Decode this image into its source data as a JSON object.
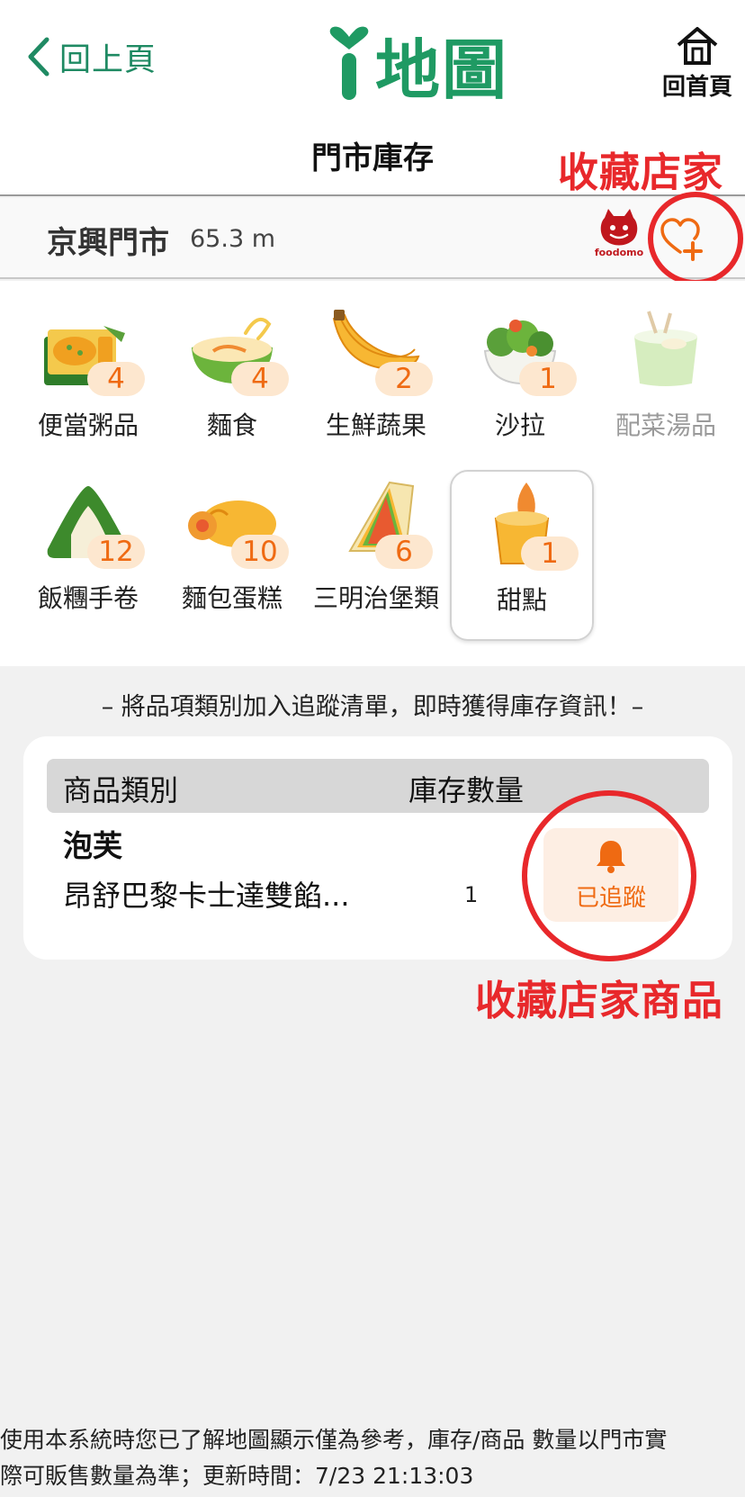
{
  "header": {
    "back_label": "回上頁",
    "logo_text": "地圖",
    "home_label": "回首頁",
    "brand_color": "#1f9a63"
  },
  "page": {
    "title": "門市庫存"
  },
  "annotations": {
    "store_fav": "收藏店家",
    "product_fav": "收藏店家商品",
    "color": "#e8282b"
  },
  "store": {
    "name": "京興門市",
    "distance": "65.3 m",
    "partner_logo": "foodomo",
    "favorite_icon": "heart-plus-icon"
  },
  "categories": [
    {
      "label": "便當粥品",
      "count": "4",
      "icon": "bento-icon"
    },
    {
      "label": "麵食",
      "count": "4",
      "icon": "noodle-bowl-icon"
    },
    {
      "label": "生鮮蔬果",
      "count": "2",
      "icon": "banana-icon"
    },
    {
      "label": "沙拉",
      "count": "1",
      "icon": "salad-icon"
    },
    {
      "label": "配菜湯品",
      "count": "",
      "icon": "soup-cup-icon"
    },
    {
      "label": "飯糰手卷",
      "count": "12",
      "icon": "rice-ball-icon"
    },
    {
      "label": "麵包蛋糕",
      "count": "10",
      "icon": "bread-icon"
    },
    {
      "label": "三明治堡類",
      "count": "6",
      "icon": "sandwich-icon"
    },
    {
      "label": "甜點",
      "count": "1",
      "icon": "dessert-icon"
    }
  ],
  "hint": "– 將品項類別加入追蹤清單，即時獲得庫存資訊！–",
  "table": {
    "col_category": "商品類別",
    "col_stock": "庫存數量",
    "group": "泡芙",
    "item_name": "昂舒巴黎卡士達雙餡...",
    "item_qty": "1",
    "follow_label": "已追蹤",
    "accent": "#ef6a12"
  },
  "footer": {
    "line1": "使用本系統時您已了解地圖顯示僅為參考，庫存/商品 數量以門市實",
    "line2": "際可販售數量為準；更新時間：7/23 21:13:03"
  }
}
